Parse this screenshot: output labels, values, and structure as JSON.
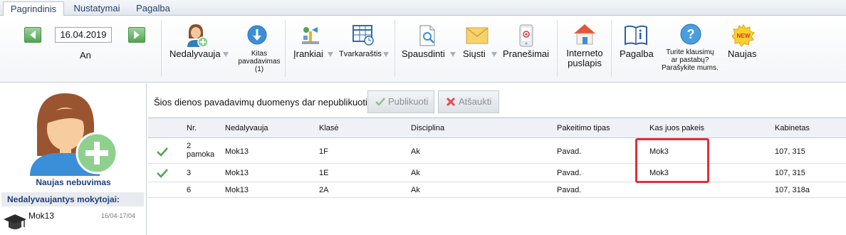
{
  "tabs": [
    {
      "label": "Pagrindinis",
      "active": true
    },
    {
      "label": "Nustatymai",
      "active": false
    },
    {
      "label": "Pagalba",
      "active": false
    }
  ],
  "date": {
    "value": "16.04.2019",
    "weekday": "An"
  },
  "ribbon": {
    "nedalyvauja": "Nedalyvauja",
    "kitas_line1": "Kitas",
    "kitas_line2": "pavadavimas",
    "kitas_line3": "(1)",
    "irankiai": "Įrankiai",
    "tvarkarastis": "Tvarkaraštis",
    "spausdinti": "Spausdinti",
    "siusti": "Siųsti",
    "pranesimai": "Pranešimai",
    "interneto_line1": "Interneto",
    "interneto_line2": "puslapis",
    "pagalba": "Pagalba",
    "klausimu_line1": "Turite klausimų",
    "klausimu_line2": "ar pastabų?",
    "klausimu_line3": "Parašykite mums.",
    "naujas": "Naujas",
    "new_badge": "NEW"
  },
  "left": {
    "caption": "Naujas nebuvimas",
    "absent_header": "Nedalyvaujantys mokytojai:",
    "teacher": {
      "name": "Mok13",
      "range": "16/04-17/04"
    }
  },
  "main": {
    "notice": "Šios dienos pavadavimų duomenys dar nepublikuoti.",
    "publish": "Publikuoti",
    "cancel": "Atšaukti"
  },
  "grid": {
    "headers": [
      "Nr.",
      "Nedalyvauja",
      "Klasė",
      "Disciplina",
      "Pakeitimo tipas",
      "Kas juos pakeis",
      "Kabinetas"
    ],
    "rows": [
      {
        "check": true,
        "nr_line1": "2",
        "nr_line2": "pamoka",
        "nedalyvauja": "Mok13",
        "klase": "1F",
        "disciplina": "Ak",
        "tipas": "Pavad.",
        "pakeis": "Mok3",
        "kabinetas": "107, 315"
      },
      {
        "check": true,
        "nr_line1": "3",
        "nr_line2": "",
        "nedalyvauja": "Mok13",
        "klase": "1E",
        "disciplina": "Ak",
        "tipas": "Pavad.",
        "pakeis": "Mok3",
        "kabinetas": "107, 315"
      },
      {
        "check": false,
        "nr_line1": "6",
        "nr_line2": "",
        "nedalyvauja": "Mok13",
        "klase": "2A",
        "disciplina": "Ak",
        "tipas": "Pavad.",
        "pakeis": "",
        "kabinetas": "107, 318a"
      }
    ]
  },
  "colors": {
    "accent": "#1f3f7a",
    "highlight": "#e03034",
    "check": "#4fa54f"
  }
}
